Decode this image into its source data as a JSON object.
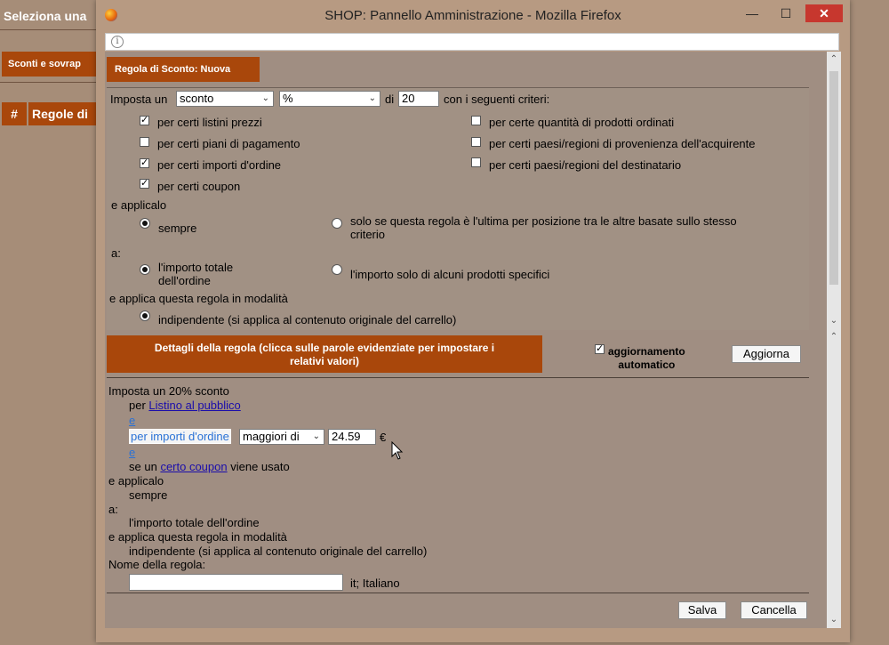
{
  "background": {
    "title": "Seleziona una",
    "tab_label": "Sconti e sovrap",
    "col_hash": "#",
    "col_regole": "Regole di"
  },
  "window": {
    "title": "SHOP: Pannello Amministrazione - Mozilla Firefox",
    "minimize_label": "—",
    "maximize_label": "☐",
    "close_label": "✕"
  },
  "rule_header": "Regola di Sconto: Nuova",
  "criteria": {
    "imposta_label": "Imposta un",
    "type_value": "sconto",
    "unit_value": "%",
    "di_label": "di",
    "amount_value": "20",
    "suffix": "con i seguenti criteri:",
    "left_checks": [
      {
        "label": "per certi listini prezzi",
        "checked": true
      },
      {
        "label": "per certi piani di pagamento",
        "checked": false
      },
      {
        "label": "per certi importi d'ordine",
        "checked": true
      },
      {
        "label": "per certi coupon",
        "checked": true
      }
    ],
    "right_checks": [
      {
        "label": "per certe quantità di prodotti ordinati",
        "checked": false
      },
      {
        "label": "per certi paesi/regioni di provenienza dell'acquirente",
        "checked": false
      },
      {
        "label": "per certi paesi/regioni del destinatario",
        "checked": false
      }
    ],
    "apply_label": "e applicalo",
    "apply_sempre": "sempre",
    "apply_last_line1": "solo se questa regola è l'ultima per posizione tra le altre basate sullo stesso",
    "apply_last_line2": "criterio",
    "a_label": "a:",
    "target_total_line1": "l'importo totale",
    "target_total_line2": "dell'ordine",
    "target_products": "l'importo solo di alcuni prodotti specifici",
    "mode_label": "e applica questa regola in modalità",
    "mode_value": "indipendente (si applica al contenuto originale del carrello)"
  },
  "details": {
    "header_line1": "Dettagli della regola (clicca sulle parole evidenziate per impostare i",
    "header_line2": "relativi valori)",
    "auto_line1": "aggiornamento",
    "auto_line2": "automatico",
    "update_button": "Aggiorna",
    "summary_title": "Imposta un 20% sconto",
    "per_label": "per",
    "listino_link": "Listino al pubblico",
    "e1": "e",
    "importi_link": "per importi d'ordine",
    "comparator": "maggiori di",
    "threshold": "24.59",
    "currency": "€",
    "e2": "e",
    "coupon_prefix": "se un",
    "coupon_link": "certo coupon",
    "coupon_suffix": "viene usato",
    "applicalo": "e applicalo",
    "sempre": "sempre",
    "a": "a:",
    "importo_totale": "l'importo totale dell'ordine",
    "modalita": "e applica questa regola in modalità",
    "indipendente": "indipendente (si applica al contenuto originale del carrello)",
    "nome_label": "Nome della regola:",
    "nome_value": "",
    "lang": "it; Italiano"
  },
  "footer": {
    "save_button": "Salva",
    "cancel_button": "Cancella"
  },
  "colors": {
    "accent": "#a9470b",
    "panel": "#a19184",
    "page_bg": "#a68d78"
  }
}
